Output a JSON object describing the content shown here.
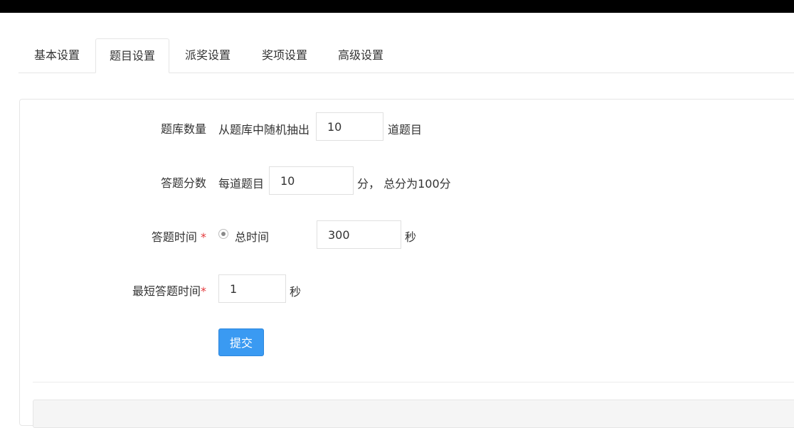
{
  "tabs": [
    {
      "label": "基本设置",
      "active": false
    },
    {
      "label": "题目设置",
      "active": true
    },
    {
      "label": "派奖设置",
      "active": false
    },
    {
      "label": "奖项设置",
      "active": false
    },
    {
      "label": "高级设置",
      "active": false
    }
  ],
  "form": {
    "question_count": {
      "label": "题库数量",
      "prefix": "从题库中随机抽出",
      "value": "10",
      "suffix": "道题目"
    },
    "score": {
      "label": "答题分数",
      "prefix": "每道题目",
      "value": "10",
      "suffix": "分， 总分为100分"
    },
    "answer_time": {
      "label": "答题时间",
      "required_mark": "*",
      "radio_label": "总时间",
      "value": "300",
      "suffix": "秒"
    },
    "min_time": {
      "label": "最短答题时间",
      "required_mark": "*",
      "value": "1",
      "suffix": "秒"
    },
    "submit_label": "提交"
  },
  "colors": {
    "primary": "#3a9af2",
    "required": "#e4393c"
  }
}
